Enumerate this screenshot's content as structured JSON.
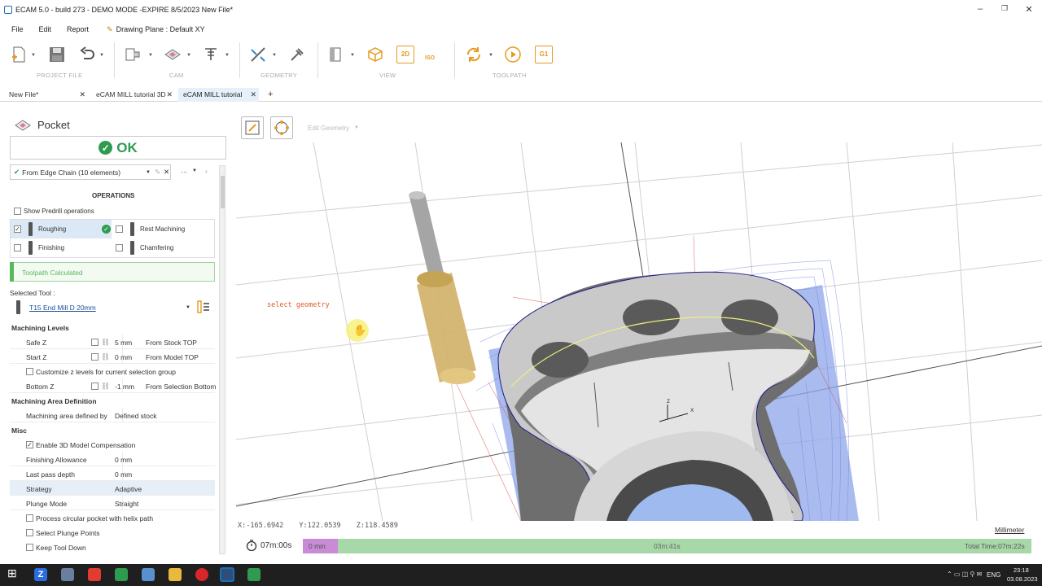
{
  "window": {
    "title": "ECAM 5.0 - build 273 - DEMO MODE -EXPIRE 8/5/2023 New File*"
  },
  "menu": {
    "file": "File",
    "edit": "Edit",
    "report": "Report",
    "drawing_plane": "Drawing Plane : Default XY"
  },
  "ribbon": {
    "groups": {
      "project": "PROJECT FILE",
      "cam": "CAM",
      "geometry": "GEOMETRY",
      "view": "VIEW",
      "toolpath": "TOOLPATH"
    },
    "btn_2d": "2D",
    "btn_iso": "ISO",
    "btn_g1": "G1"
  },
  "tabs": [
    {
      "label": "New File*"
    },
    {
      "label": "eCAM MILL tutorial 3D"
    },
    {
      "label": "eCAM MILL tutorial"
    }
  ],
  "panel": {
    "title": "Pocket",
    "ok_label": "OK",
    "chain": "From Edge Chain (10 elements)",
    "chain_more": "···",
    "operations_header": "OPERATIONS",
    "show_predrill": "Show Predrill operations",
    "ops": {
      "roughing": "Roughing",
      "rest": "Rest Machining",
      "finishing": "Finishing",
      "chamfering": "Chamfering"
    },
    "status": "Toolpath Calculated",
    "selected_tool_label": "Selected Tool :",
    "tool_name": "T15 End Mill D 20mm",
    "machining_levels": "Machining Levels",
    "safe_z": {
      "label": "Safe Z",
      "value": "5 mm",
      "ref": "From Stock TOP"
    },
    "start_z": {
      "label": "Start Z",
      "value": "0 mm",
      "ref": "From Model TOP"
    },
    "customize_z": "Customize z levels for current selection group",
    "bottom_z": {
      "label": "Bottom Z",
      "value": "-1 mm",
      "ref": "From Selection Bottom"
    },
    "area_def": "Machining Area Definition",
    "area_row": {
      "label": "Machining area defined by",
      "value": "Defined stock"
    },
    "misc": "Misc",
    "enable_3d": "Enable 3D Model Compensation",
    "finishing_allowance": {
      "label": "Finishing Allowance",
      "value": "0 mm"
    },
    "last_pass": {
      "label": "Last pass depth",
      "value": "0 mm"
    },
    "strategy": {
      "label": "Strategy",
      "value": "Adaptive"
    },
    "plunge": {
      "label": "Plunge Mode",
      "value": "Straight"
    },
    "helix": "Process circular pocket with helix path",
    "plunge_points": "Select Plunge Points",
    "keep_tool": "Keep Tool Down"
  },
  "viewport": {
    "edit_geometry": "Edit Geometry",
    "hint": "select geometry",
    "axis_x": "X",
    "axis_z": "Z",
    "coords": {
      "x": "X:-165.6942",
      "y": "Y:122.0539",
      "z": "Z:118.4589"
    },
    "unit": "Millimeter"
  },
  "timeline": {
    "elapsed": "07m:00s",
    "start": "0 min",
    "mid": "03m:41s",
    "total": "Total Time:07m:22s"
  },
  "taskbar": {
    "lang": "ENG",
    "time": "23:18",
    "date": "03.08.2023"
  },
  "colors": {
    "accent": "#2e9b4f",
    "toolpath_blue": "#4a6fe0",
    "timeline_green": "#a8d8a8",
    "timeline_purple": "#c98ad6"
  }
}
